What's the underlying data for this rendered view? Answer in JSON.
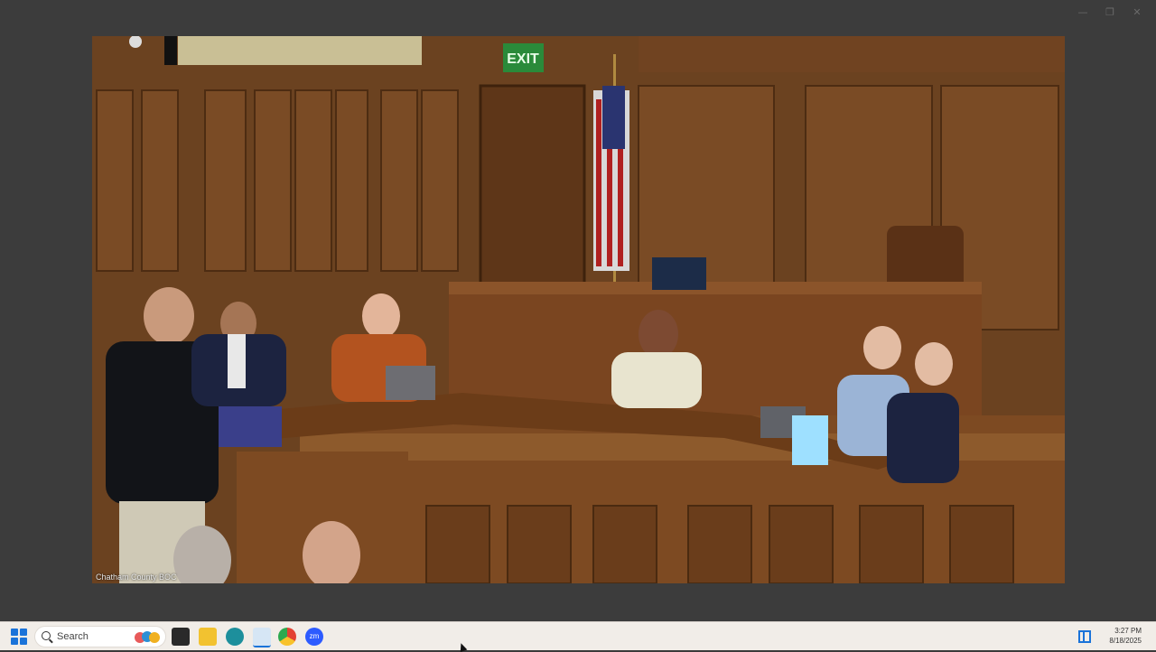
{
  "window": {
    "controls": {
      "minimize": "—",
      "maximize": "❐",
      "close": "✕"
    }
  },
  "video": {
    "caption": "Chatham County BOC",
    "sign_text": "EXIT"
  },
  "taskbar": {
    "search_label": "Search",
    "apps": [
      {
        "name": "file-explorer-dark-icon"
      },
      {
        "name": "file-explorer-icon"
      },
      {
        "name": "edge-icon"
      },
      {
        "name": "app-icon"
      },
      {
        "name": "chrome-icon"
      },
      {
        "name": "zoom-icon",
        "label": "zm"
      }
    ],
    "clock": {
      "time": "3:27 PM",
      "date": "8/18/2025"
    }
  },
  "colors": {
    "accent": "#1a73d9",
    "taskbar_bg": "#f1ede8",
    "window_bg": "#3c3c3c"
  }
}
